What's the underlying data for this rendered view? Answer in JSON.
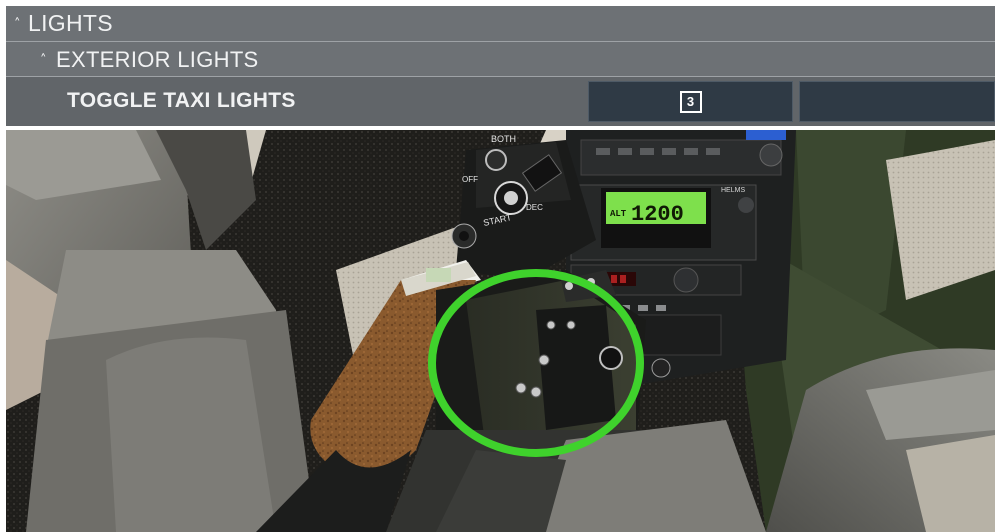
{
  "menu": {
    "lights": {
      "label": "LIGHTS",
      "icon": "chevron-up-icon"
    },
    "exterior_lights": {
      "label": "EXTERIOR LIGHTS",
      "icon": "chevron-up-icon"
    },
    "binding": {
      "label": "TOGGLE TAXI LIGHTS",
      "primary_key": "3",
      "secondary_key": ""
    }
  },
  "scene": {
    "starter_knob": {
      "top": "BOTH",
      "left": "OFF",
      "bottom": "START",
      "dec": "DEC"
    },
    "display": {
      "mode": "ALT",
      "value": "1200"
    },
    "highlight_color": "#3fd22c"
  }
}
